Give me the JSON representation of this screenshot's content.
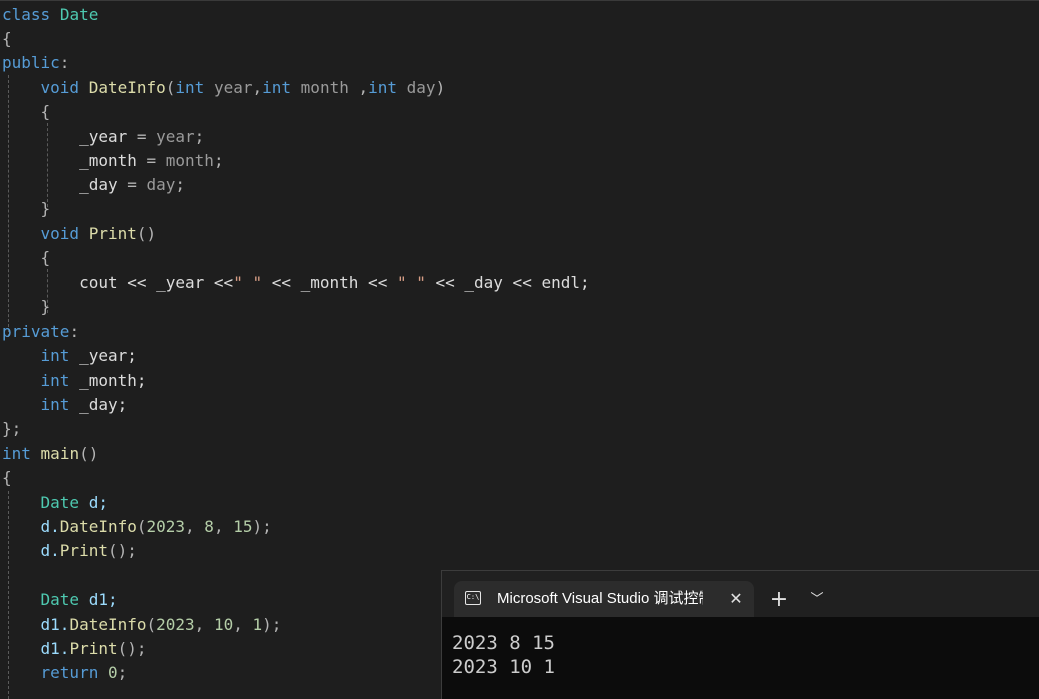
{
  "code": {
    "l1": [
      "class",
      "Date"
    ],
    "l2": [
      "{"
    ],
    "l3": [
      "public",
      ":"
    ],
    "l4": [
      "void",
      "DateInfo",
      "(",
      "int",
      "year",
      ",",
      "int",
      "month",
      " ,",
      "int",
      "day",
      ")"
    ],
    "l5": [
      "{"
    ],
    "l6": [
      "_year",
      " = ",
      "year",
      ";"
    ],
    "l7": [
      "_month",
      " = ",
      "month",
      ";"
    ],
    "l8": [
      "_day",
      " = ",
      "day",
      ";"
    ],
    "l9": [
      "}"
    ],
    "l10": [
      "void",
      "Print",
      "()"
    ],
    "l11": [
      "{"
    ],
    "l12": [
      "cout << _year <<",
      "\" \"",
      " << _month << ",
      "\" \"",
      " << _day << endl;"
    ],
    "l13": [
      "}"
    ],
    "l14": [
      "private",
      ":"
    ],
    "l15": [
      "int",
      " _year;"
    ],
    "l16": [
      "int",
      " _month;"
    ],
    "l17": [
      "int",
      " _day;"
    ],
    "l18": [
      "};"
    ],
    "l19": [
      "int",
      "main",
      "()"
    ],
    "l20": [
      "{"
    ],
    "l21": [
      "Date",
      " d;"
    ],
    "l22": [
      "d.",
      "DateInfo",
      "(",
      "2023",
      ", ",
      "8",
      ", ",
      "15",
      ");"
    ],
    "l23": [
      "d.",
      "Print",
      "();"
    ],
    "l25": [
      "Date",
      " d1;"
    ],
    "l26": [
      "d1.",
      "DateInfo",
      "(",
      "2023",
      ", ",
      "10",
      ", ",
      "1",
      ");"
    ],
    "l27": [
      "d1.",
      "Print",
      "();"
    ],
    "l28": [
      "return",
      "0",
      ";"
    ]
  },
  "terminal": {
    "tab_icon_text": "C:\\",
    "tab_title": "Microsoft Visual Studio 调试控制台",
    "close_icon": "close-icon",
    "new_tab_icon": "plus-icon",
    "dropdown_icon": "chevron-down-icon",
    "output": [
      "2023 8 15",
      "2023 10 1"
    ]
  },
  "colors": {
    "background": "#1e1e1e",
    "keyword": "#569cd6",
    "type": "#4ec9b0",
    "function": "#dcdcaa",
    "parameter": "#9a9a9a",
    "number": "#b5cea8",
    "string": "#d69d85",
    "terminal_background": "#0c0c0c",
    "terminal_tab": "#2c2c2c"
  }
}
